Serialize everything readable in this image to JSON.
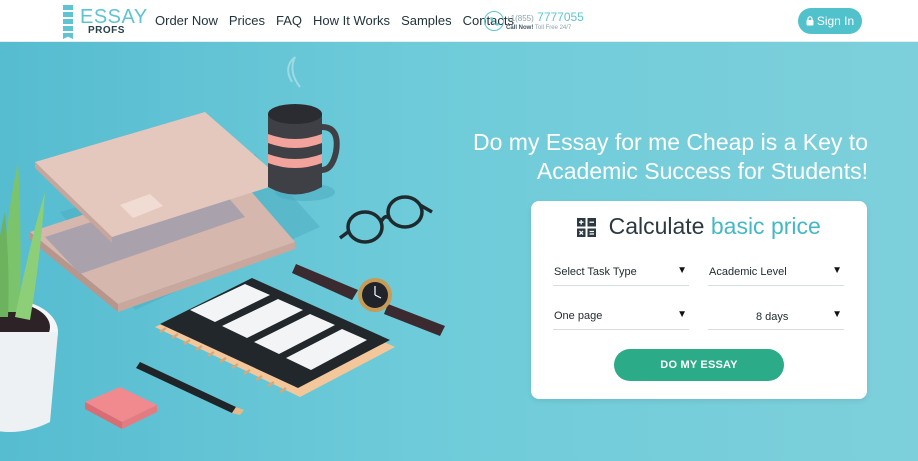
{
  "brand": {
    "line1": "ESSAY",
    "line2": "PROFS"
  },
  "nav": {
    "items": [
      {
        "label": "Order Now"
      },
      {
        "label": "Prices"
      },
      {
        "label": "FAQ"
      },
      {
        "label": "How It Works"
      },
      {
        "label": "Samples"
      },
      {
        "label": "Contacts"
      }
    ]
  },
  "phone": {
    "prefix": "+1(855)",
    "number": "7777055",
    "call_now": "Call Now!",
    "toll_free": "Toll Free 24/7",
    "icon": "phone-icon"
  },
  "header": {
    "signin_label": "Sign In",
    "signin_icon": "lock-icon"
  },
  "hero": {
    "title_line1": "Do my Essay for me Cheap is a Key to",
    "title_line2": "Academic Success for Students!"
  },
  "calculator": {
    "heading_main": "Calculate",
    "heading_accent": "basic price",
    "icon": "calculator-icon",
    "task_type": "Select Task Type",
    "academic_level": "Academic Level",
    "pages": "One page",
    "deadline": "8 days",
    "submit_label": "DO MY ESSAY"
  },
  "colors": {
    "accent": "#5fc4d1",
    "hero_bg": "#6ecbd9",
    "button_green": "#2bab88",
    "text_dark": "#22343b"
  }
}
